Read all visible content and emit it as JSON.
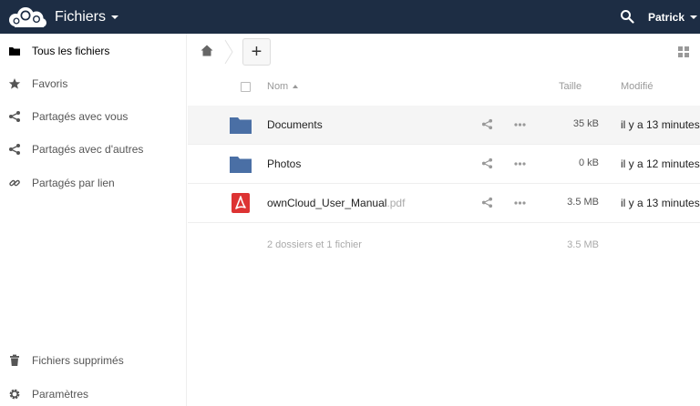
{
  "header": {
    "app_title": "Fichiers",
    "user_name": "Patrick",
    "bg_color": "#1d2d44"
  },
  "sidebar": {
    "items": [
      {
        "label": "Tous les fichiers",
        "icon": "folder-icon"
      },
      {
        "label": "Favoris",
        "icon": "star-icon"
      },
      {
        "label": "Partagés avec vous",
        "icon": "share-icon"
      },
      {
        "label": "Partagés avec d'autres",
        "icon": "share-icon"
      },
      {
        "label": "Partagés par lien",
        "icon": "link-icon"
      }
    ],
    "bottom": [
      {
        "label": "Fichiers supprimés",
        "icon": "trash-icon"
      },
      {
        "label": "Paramètres",
        "icon": "gear-icon"
      }
    ]
  },
  "controls": {
    "new_label": "+"
  },
  "table": {
    "headers": {
      "name": "Nom",
      "size": "Taille",
      "modified": "Modifié"
    },
    "rows": [
      {
        "name": "Documents",
        "ext": "",
        "type": "folder",
        "size": "35 kB",
        "modified": "il y a 13 minutes"
      },
      {
        "name": "Photos",
        "ext": "",
        "type": "folder",
        "size": "0 kB",
        "modified": "il y a 12 minutes"
      },
      {
        "name": "ownCloud_User_Manual",
        "ext": ".pdf",
        "type": "pdf",
        "size": "3.5 MB",
        "modified": "il y a 13 minutes"
      }
    ],
    "summary": {
      "count": "2 dossiers et 1 fichier",
      "total": "3.5 MB"
    }
  },
  "colors": {
    "folder": "#4a6fa5",
    "pdf": "#dd3333",
    "accent": "#1d2d44"
  }
}
